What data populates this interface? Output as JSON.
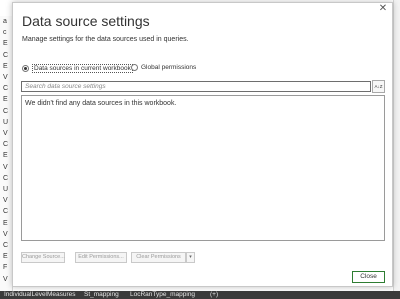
{
  "dialog": {
    "title": "Data source settings",
    "subtitle": "Manage settings for the data sources used in queries.",
    "close_glyph": "✕",
    "scope_options": [
      {
        "label": "Data sources in current workbook",
        "selected": true
      },
      {
        "label": "Global permissions",
        "selected": false
      }
    ],
    "search_placeholder": "Search data source settings",
    "sort_icon_glyph": "A↓Z",
    "empty_message": "We didn't find any data sources in this workbook.",
    "buttons": {
      "change_source": "Change Source...",
      "edit_permissions": "Edit Permissions...",
      "clear_permissions": "Clear Permissions",
      "clear_dropdown_glyph": "▾",
      "close": "Close"
    }
  },
  "background": {
    "left_column_letters": [
      "a",
      "c",
      "E",
      "C",
      "E",
      "V",
      "C",
      "E",
      "C",
      "U",
      "V",
      "C",
      "E",
      "V",
      "C",
      "U",
      "V",
      "C",
      "E",
      "V",
      "C",
      "E",
      "F",
      "V"
    ],
    "status_items": [
      "IndividualLevelMeasures",
      "St_mapping",
      "LocRanType_mapping",
      "(+)"
    ]
  },
  "colors": {
    "title_text": "#333333",
    "accent_green": "#2e7d32",
    "disabled_text": "#9a9a9a"
  }
}
